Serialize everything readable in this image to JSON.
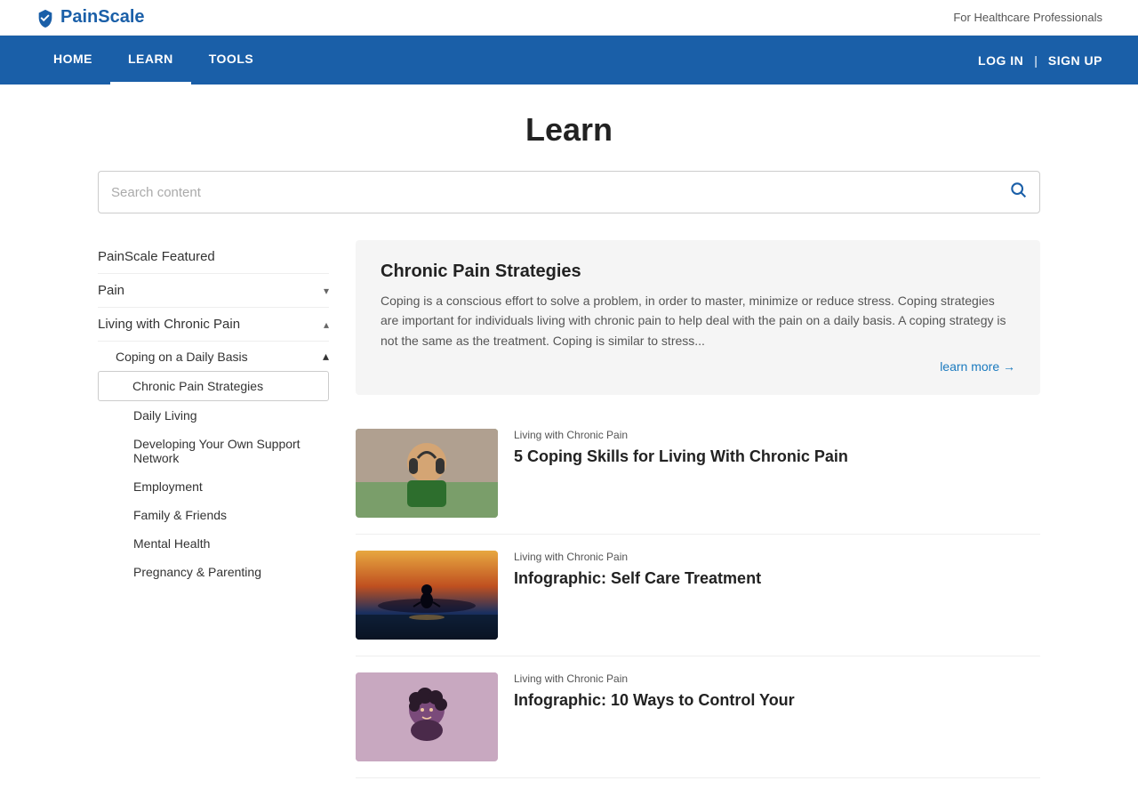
{
  "topBar": {
    "logoText": "PainScale",
    "forProfessionals": "For Healthcare Professionals"
  },
  "nav": {
    "items": [
      {
        "label": "HOME",
        "active": false
      },
      {
        "label": "LEARN",
        "active": true
      },
      {
        "label": "TOOLS",
        "active": false
      }
    ],
    "login": "LOG IN",
    "divider": "|",
    "signup": "SIGN UP"
  },
  "pageTitle": "Learn",
  "search": {
    "placeholder": "Search content"
  },
  "sidebar": {
    "items": [
      {
        "label": "PainScale Featured",
        "indent": 0,
        "chevron": ""
      },
      {
        "label": "Pain",
        "indent": 0,
        "chevron": "▾"
      },
      {
        "label": "Living with Chronic Pain",
        "indent": 0,
        "chevron": "▴"
      },
      {
        "label": "Coping on a Daily Basis",
        "indent": 1,
        "chevron": "▴"
      },
      {
        "label": "Chronic Pain Strategies",
        "indent": 2,
        "active": true
      },
      {
        "label": "Daily Living",
        "indent": 2
      },
      {
        "label": "Developing Your Own Support Network",
        "indent": 2
      },
      {
        "label": "Employment",
        "indent": 2
      },
      {
        "label": "Family & Friends",
        "indent": 2
      },
      {
        "label": "Mental Health",
        "indent": 2
      },
      {
        "label": "Pregnancy & Parenting",
        "indent": 2
      }
    ]
  },
  "featuredArticle": {
    "title": "Chronic Pain Strategies",
    "body": "Coping is a conscious effort to solve a problem, in order to master, minimize or reduce stress. Coping strategies are important for individuals living with chronic pain to help deal with the pain on a daily basis. A coping strategy is not the same as the treatment. Coping is similar to stress...",
    "learnMore": "learn more →"
  },
  "articles": [
    {
      "category": "Living with Chronic Pain",
      "title": "5 Coping Skills for Living With Chronic Pain",
      "thumb": "1"
    },
    {
      "category": "Living with Chronic Pain",
      "title": "Infographic: Self Care Treatment",
      "thumb": "2"
    },
    {
      "category": "Living with Chronic Pain",
      "title": "Infographic: 10 Ways to Control Your",
      "thumb": "3"
    }
  ]
}
